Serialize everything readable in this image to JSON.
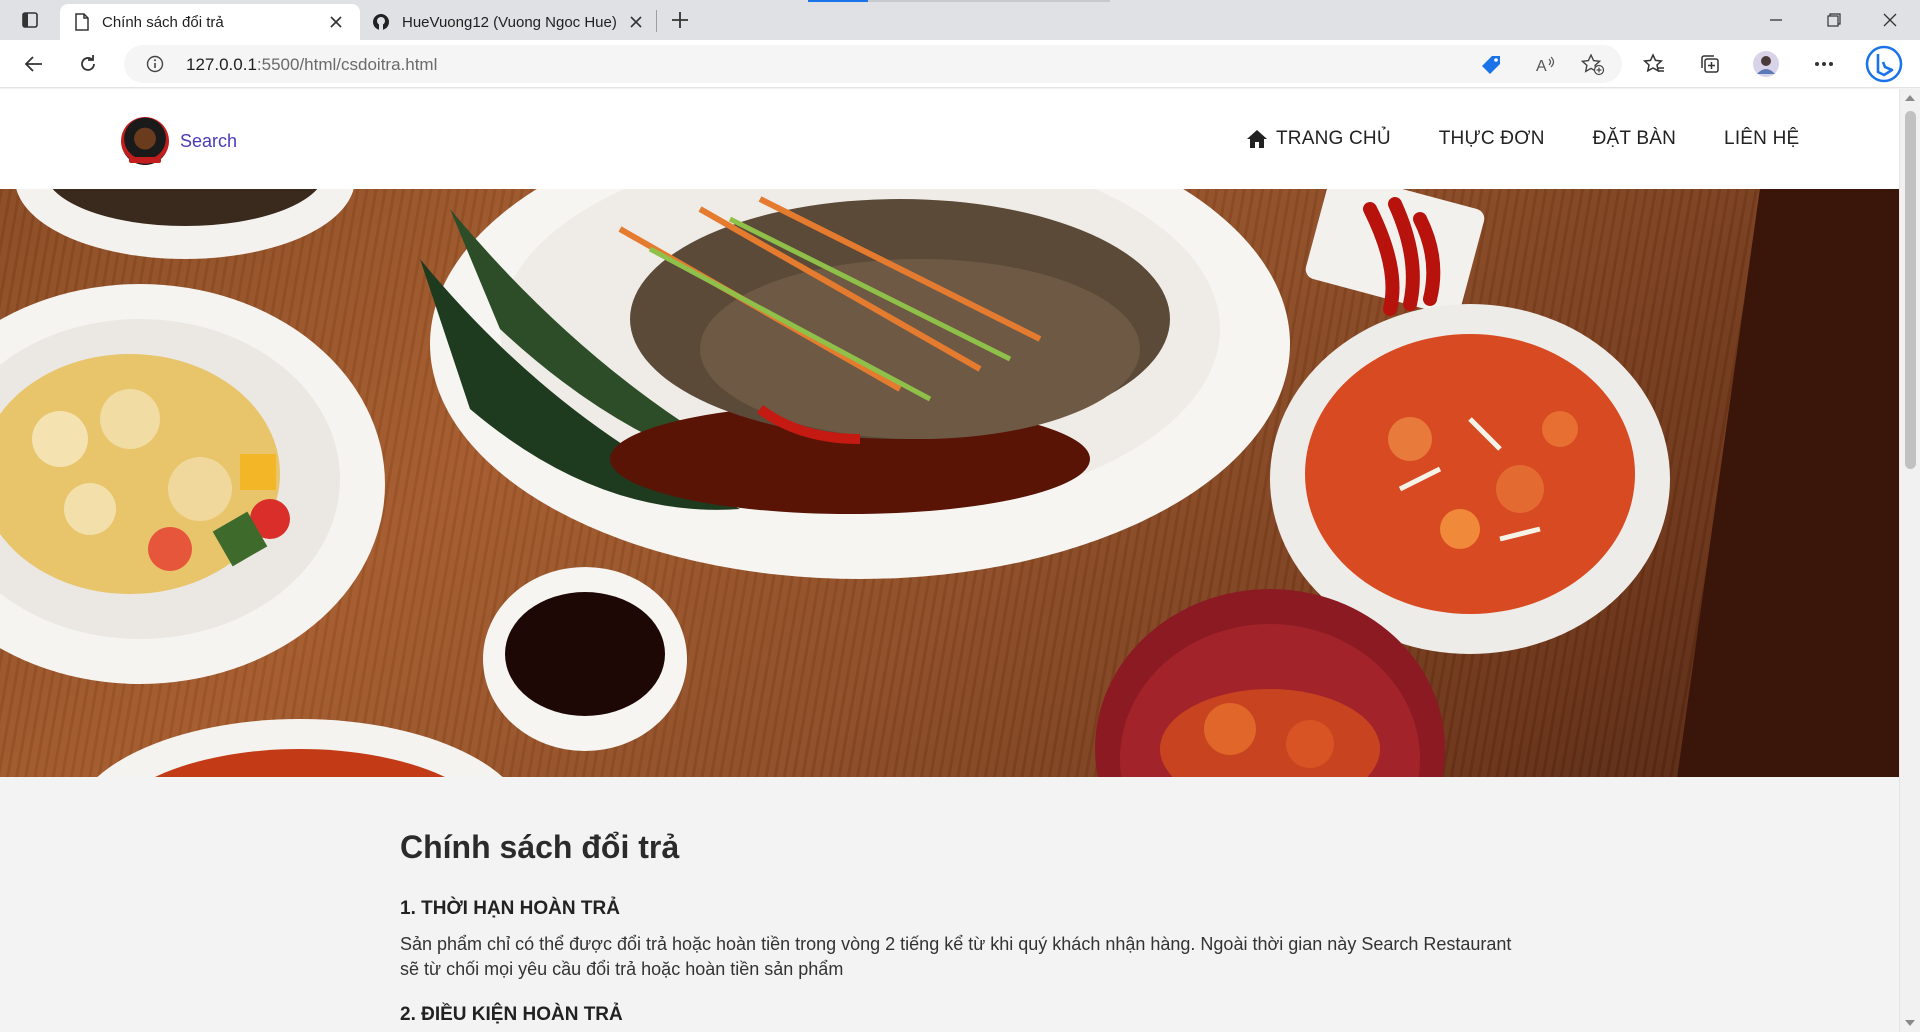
{
  "browser": {
    "tabs": [
      {
        "title": "Chính sách đổi trả",
        "active": true
      },
      {
        "title": "HueVuong12 (Vuong Ngoc Hue)",
        "active": false
      }
    ],
    "url_host": "127.0.0.1",
    "url_path": ":5500/html/csdoitra.html",
    "accent_color": "#1a73e8"
  },
  "site": {
    "brand": "Search",
    "nav": [
      {
        "label": "TRANG CHỦ",
        "icon": "home-icon"
      },
      {
        "label": "THỰC ĐƠN"
      },
      {
        "label": "ĐẶT BÀN"
      },
      {
        "label": "LIÊN HỆ"
      }
    ]
  },
  "policy": {
    "heading": "Chính sách đổi trả",
    "sections": [
      {
        "title": "1. THỜI HẠN HOÀN TRẢ",
        "body": "Sản phẩm chỉ có thể được đổi trả hoặc hoàn tiền trong vòng 2 tiếng kể từ khi quý khách nhận hàng. Ngoài thời gian này Search Restaurant sẽ từ chối mọi yêu cầu đổi trả hoặc hoàn tiền sản phẩm"
      },
      {
        "title": "2. ĐIỀU KIỆN HOÀN TRẢ"
      }
    ]
  }
}
